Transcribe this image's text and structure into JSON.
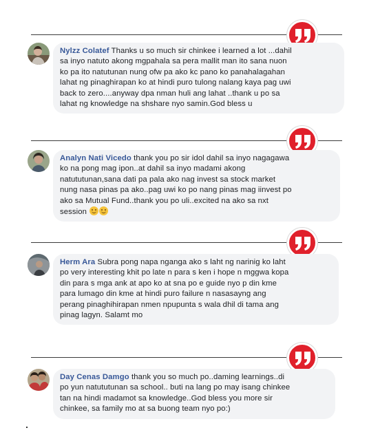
{
  "colors": {
    "quote_red": "#e0202b",
    "bubble_bg": "#f2f3f5",
    "author_blue": "#385898",
    "divider": "#3a3a3a"
  },
  "icons": {
    "quote": "quote-marks-icon",
    "emoji": "smiling-face-emoji-icon"
  },
  "comments": [
    {
      "author": "Nylzz Colatef",
      "lines": [
        "Thanks u so much sir chinkee i learned a lot ...dahil",
        "sa inyo natuto akong mgpahala sa pera mallit man ito sana nuon",
        "ko pa ito natutunan nung ofw pa ako kc pano ko panahalagahan",
        "lahat ng pinaghirapan ko at hindi puro tulong nalang kaya pag uwi",
        "back to zero....anyway dpa nman huli ang lahat ..thank u po sa",
        "lahat ng knowledge na shshare nyo samin.God bless u"
      ]
    },
    {
      "author": "Analyn Nati Vicedo",
      "lines": [
        "thank you po sir idol dahil sa inyo nagagawa",
        "ko na pong mag ipon..at dahil sa inyo madami akong",
        "natututunan,sana dati pa pala ako nag invest sa stock market",
        "nung nasa pinas pa ako..pag uwi ko po nang pinas mag iinvest po",
        "ako sa Mutual Fund..thank you po uli..excited na ako sa nxt",
        "session"
      ]
    },
    {
      "author": "Herm Ara",
      "lines": [
        "Subra pong napa nganga ako s laht ng narinig ko laht",
        "po very interesting khit po late n para s ken i hope n mggwa kopa",
        "din para s mga ank at apo ko at sna po e guide nyo p din kme",
        "para lumago din kme at hindi puro failure n nasasayng ang",
        "perang pinaghihirapan nmen npupunta s wala dhil di tama ang",
        "pinag lagyn. Salamt mo"
      ]
    },
    {
      "author": "Day Cenas Damgo",
      "lines": [
        "thank you so much po..daming learnings..di",
        "po yun natututunan sa school.. buti na lang po may isang chinkee",
        "tan na hindi madamot sa knowledge..God bless you more sir",
        "chinkee, sa family mo at sa buong team nyo po:)"
      ]
    }
  ]
}
